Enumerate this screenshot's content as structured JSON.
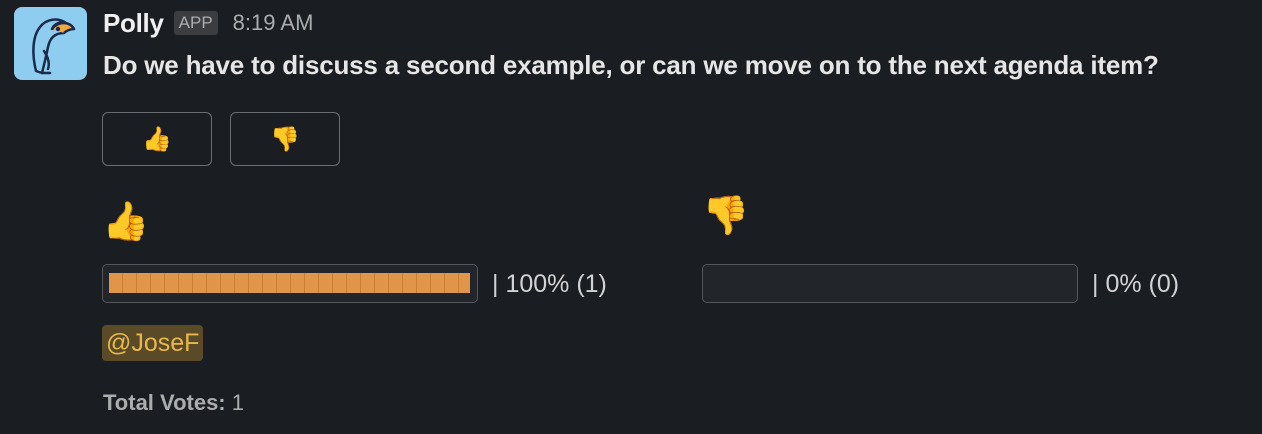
{
  "message": {
    "sender": "Polly",
    "badge": "APP",
    "time": "8:19 AM",
    "question": "Do we have to discuss a second example, or can we move on to the next agenda item?"
  },
  "buttons": [
    {
      "icon": "thumbs-up-icon",
      "emoji": "👍"
    },
    {
      "icon": "thumbs-down-icon",
      "emoji": "👎"
    }
  ],
  "results": [
    {
      "icon": "thumbs-up-icon",
      "emoji": "👍",
      "label": "|  100% (1)",
      "fraction": 1.0
    },
    {
      "icon": "thumbs-down-icon",
      "emoji": "👎",
      "label": "|  0% (0)",
      "fraction": 0.0
    }
  ],
  "voters": [
    "@JoseF"
  ],
  "total": {
    "label": "Total Votes:",
    "value": "1"
  },
  "colors": {
    "background": "#1a1d21",
    "bar_fill": "#e0954a",
    "mention_bg": "#5b4a28",
    "mention_text": "#e8b84a",
    "avatar_bg": "#8ecdf0"
  }
}
